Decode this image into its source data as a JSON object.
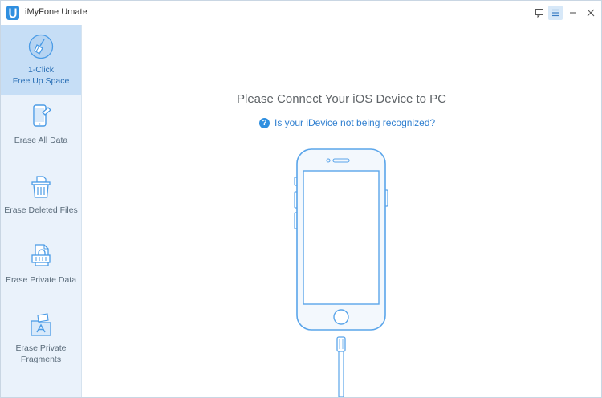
{
  "app": {
    "title": "iMyFone Umate"
  },
  "titlebar": {
    "buttons": [
      {
        "name": "feedback",
        "icon": "chat-bubble-icon"
      },
      {
        "name": "menu",
        "icon": "hamburger-menu-icon"
      },
      {
        "name": "minimize",
        "icon": "minimize-icon"
      },
      {
        "name": "close",
        "icon": "close-icon"
      }
    ]
  },
  "sidebar": {
    "items": [
      {
        "label": "1-Click\nFree Up Space",
        "icon": "broom-icon",
        "active": true
      },
      {
        "label": "Erase All Data",
        "icon": "phone-eraser-icon",
        "active": false
      },
      {
        "label": "Erase Deleted Files",
        "icon": "trash-file-icon",
        "active": false
      },
      {
        "label": "Erase Private Data",
        "icon": "lock-file-icon",
        "active": false
      },
      {
        "label": "Erase Private\nFragments",
        "icon": "fragments-folder-icon",
        "active": false
      }
    ]
  },
  "main": {
    "title": "Please Connect Your iOS Device to PC",
    "help_link": "Is your iDevice not being recognized?",
    "help_icon": "?"
  },
  "colors": {
    "accent": "#2f8fe0",
    "sidebar_bg": "#eaf2fb",
    "sidebar_active": "#c6def6",
    "icon_stroke": "#4a9be6"
  }
}
